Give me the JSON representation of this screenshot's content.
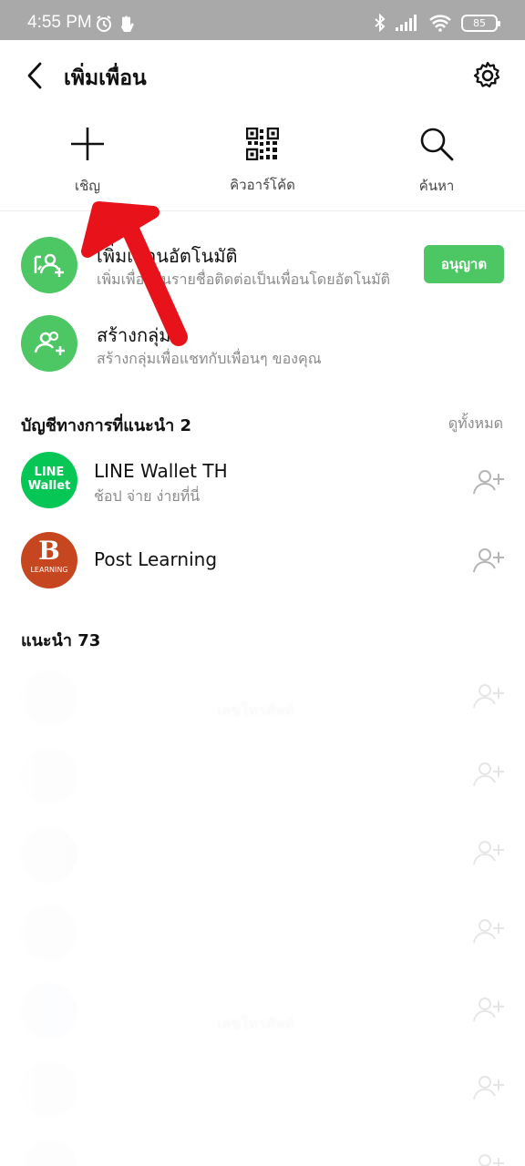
{
  "status_bar": {
    "time": "4:55 PM",
    "battery": "85"
  },
  "header": {
    "title": "เพิ่มเพื่อน"
  },
  "tools": [
    {
      "label": "เชิญ",
      "icon": "plus-icon"
    },
    {
      "label": "คิวอาร์โค้ด",
      "icon": "qr-code-icon"
    },
    {
      "label": "ค้นหา",
      "icon": "search-icon"
    }
  ],
  "features": [
    {
      "title": "เพิ่มเพื่อนอัตโนมัติ",
      "subtitle": "เพิ่มเพื่อนในรายชื่อติดต่อเป็นเพื่อนโดยอัตโนมัติ",
      "button": "อนุญาต"
    },
    {
      "title": "สร้างกลุ่ม",
      "subtitle": "สร้างกลุ่มเพื่อแชทกับเพื่อนๆ ของคุณ"
    }
  ],
  "official": {
    "title": "บัญชีทางการที่แนะนำ 2",
    "see_all": "ดูทั้งหมด",
    "accounts": [
      {
        "name": "LINE Wallet TH",
        "desc": "ช้อป จ่าย ง่ายที่นี่",
        "logo_text_1": "LINE",
        "logo_text_2": "Wallet"
      },
      {
        "name": "Post Learning",
        "desc": "",
        "logo_text_1": "B",
        "logo_text_2": "LEARNING"
      }
    ]
  },
  "suggested": {
    "title": "แนะนำ 73",
    "items": [
      {
        "desc": "เลขโทรศัพท์"
      },
      {
        "desc": ""
      },
      {
        "desc": ""
      },
      {
        "desc": ""
      },
      {
        "desc": "เลขโทรศัพท์"
      },
      {
        "desc": ""
      }
    ]
  },
  "colors": {
    "accent": "#4cc764",
    "arrow": "#e8131a",
    "status_bar": "#a9a9a9"
  }
}
